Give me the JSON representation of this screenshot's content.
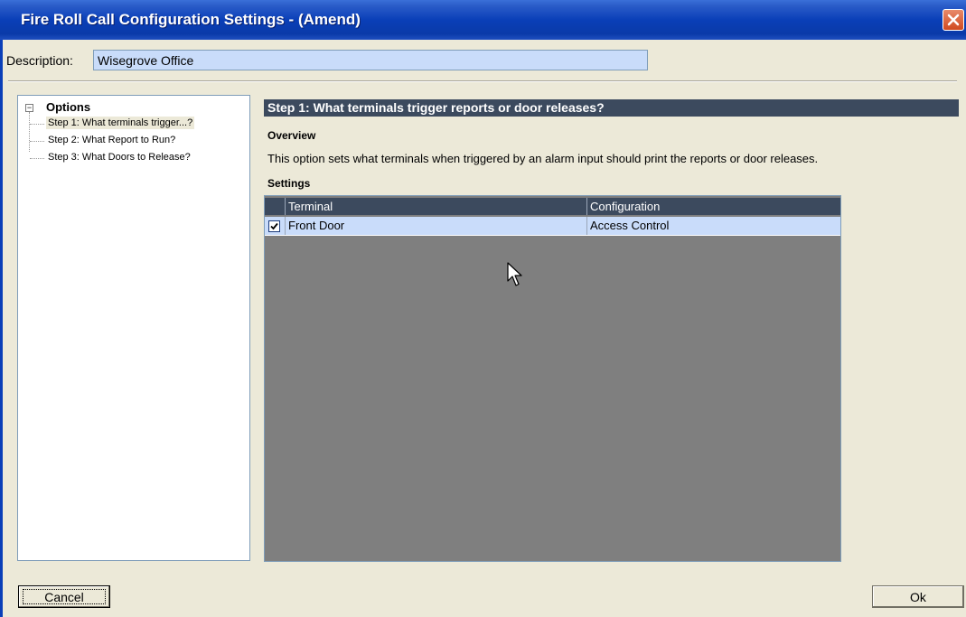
{
  "window": {
    "title": "Fire Roll Call Configuration Settings - (Amend)"
  },
  "description": {
    "label": "Description:",
    "value": "Wisegrove Office"
  },
  "tree": {
    "root": "Options",
    "expander": "−",
    "items": [
      {
        "label": "Step 1: What terminals trigger...?",
        "selected": true
      },
      {
        "label": "Step 2: What Report to Run?",
        "selected": false
      },
      {
        "label": "Step 3: What Doors to Release?",
        "selected": false
      }
    ]
  },
  "panel": {
    "title": "Step 1: What terminals trigger reports or door releases?",
    "overview_heading": "Overview",
    "overview_text": "This option sets what terminals when triggered by an alarm input should print the reports or door releases.",
    "settings_heading": "Settings"
  },
  "grid": {
    "columns": [
      "Terminal",
      "Configuration"
    ],
    "rows": [
      {
        "checked": true,
        "terminal": "Front Door",
        "configuration": "Access Control"
      }
    ]
  },
  "buttons": {
    "cancel": "Cancel",
    "ok": "Ok"
  },
  "colors": {
    "title_bar": "#0a3fb8",
    "header_bar": "#3c4a5e",
    "selected_row": "#c9dcfa",
    "grid_background": "#7f7f7f",
    "dialog_background": "#ece9d8"
  },
  "icons": {
    "close": "close-x-icon",
    "cursor": "mouse-pointer-icon",
    "check": "checkmark-icon"
  }
}
